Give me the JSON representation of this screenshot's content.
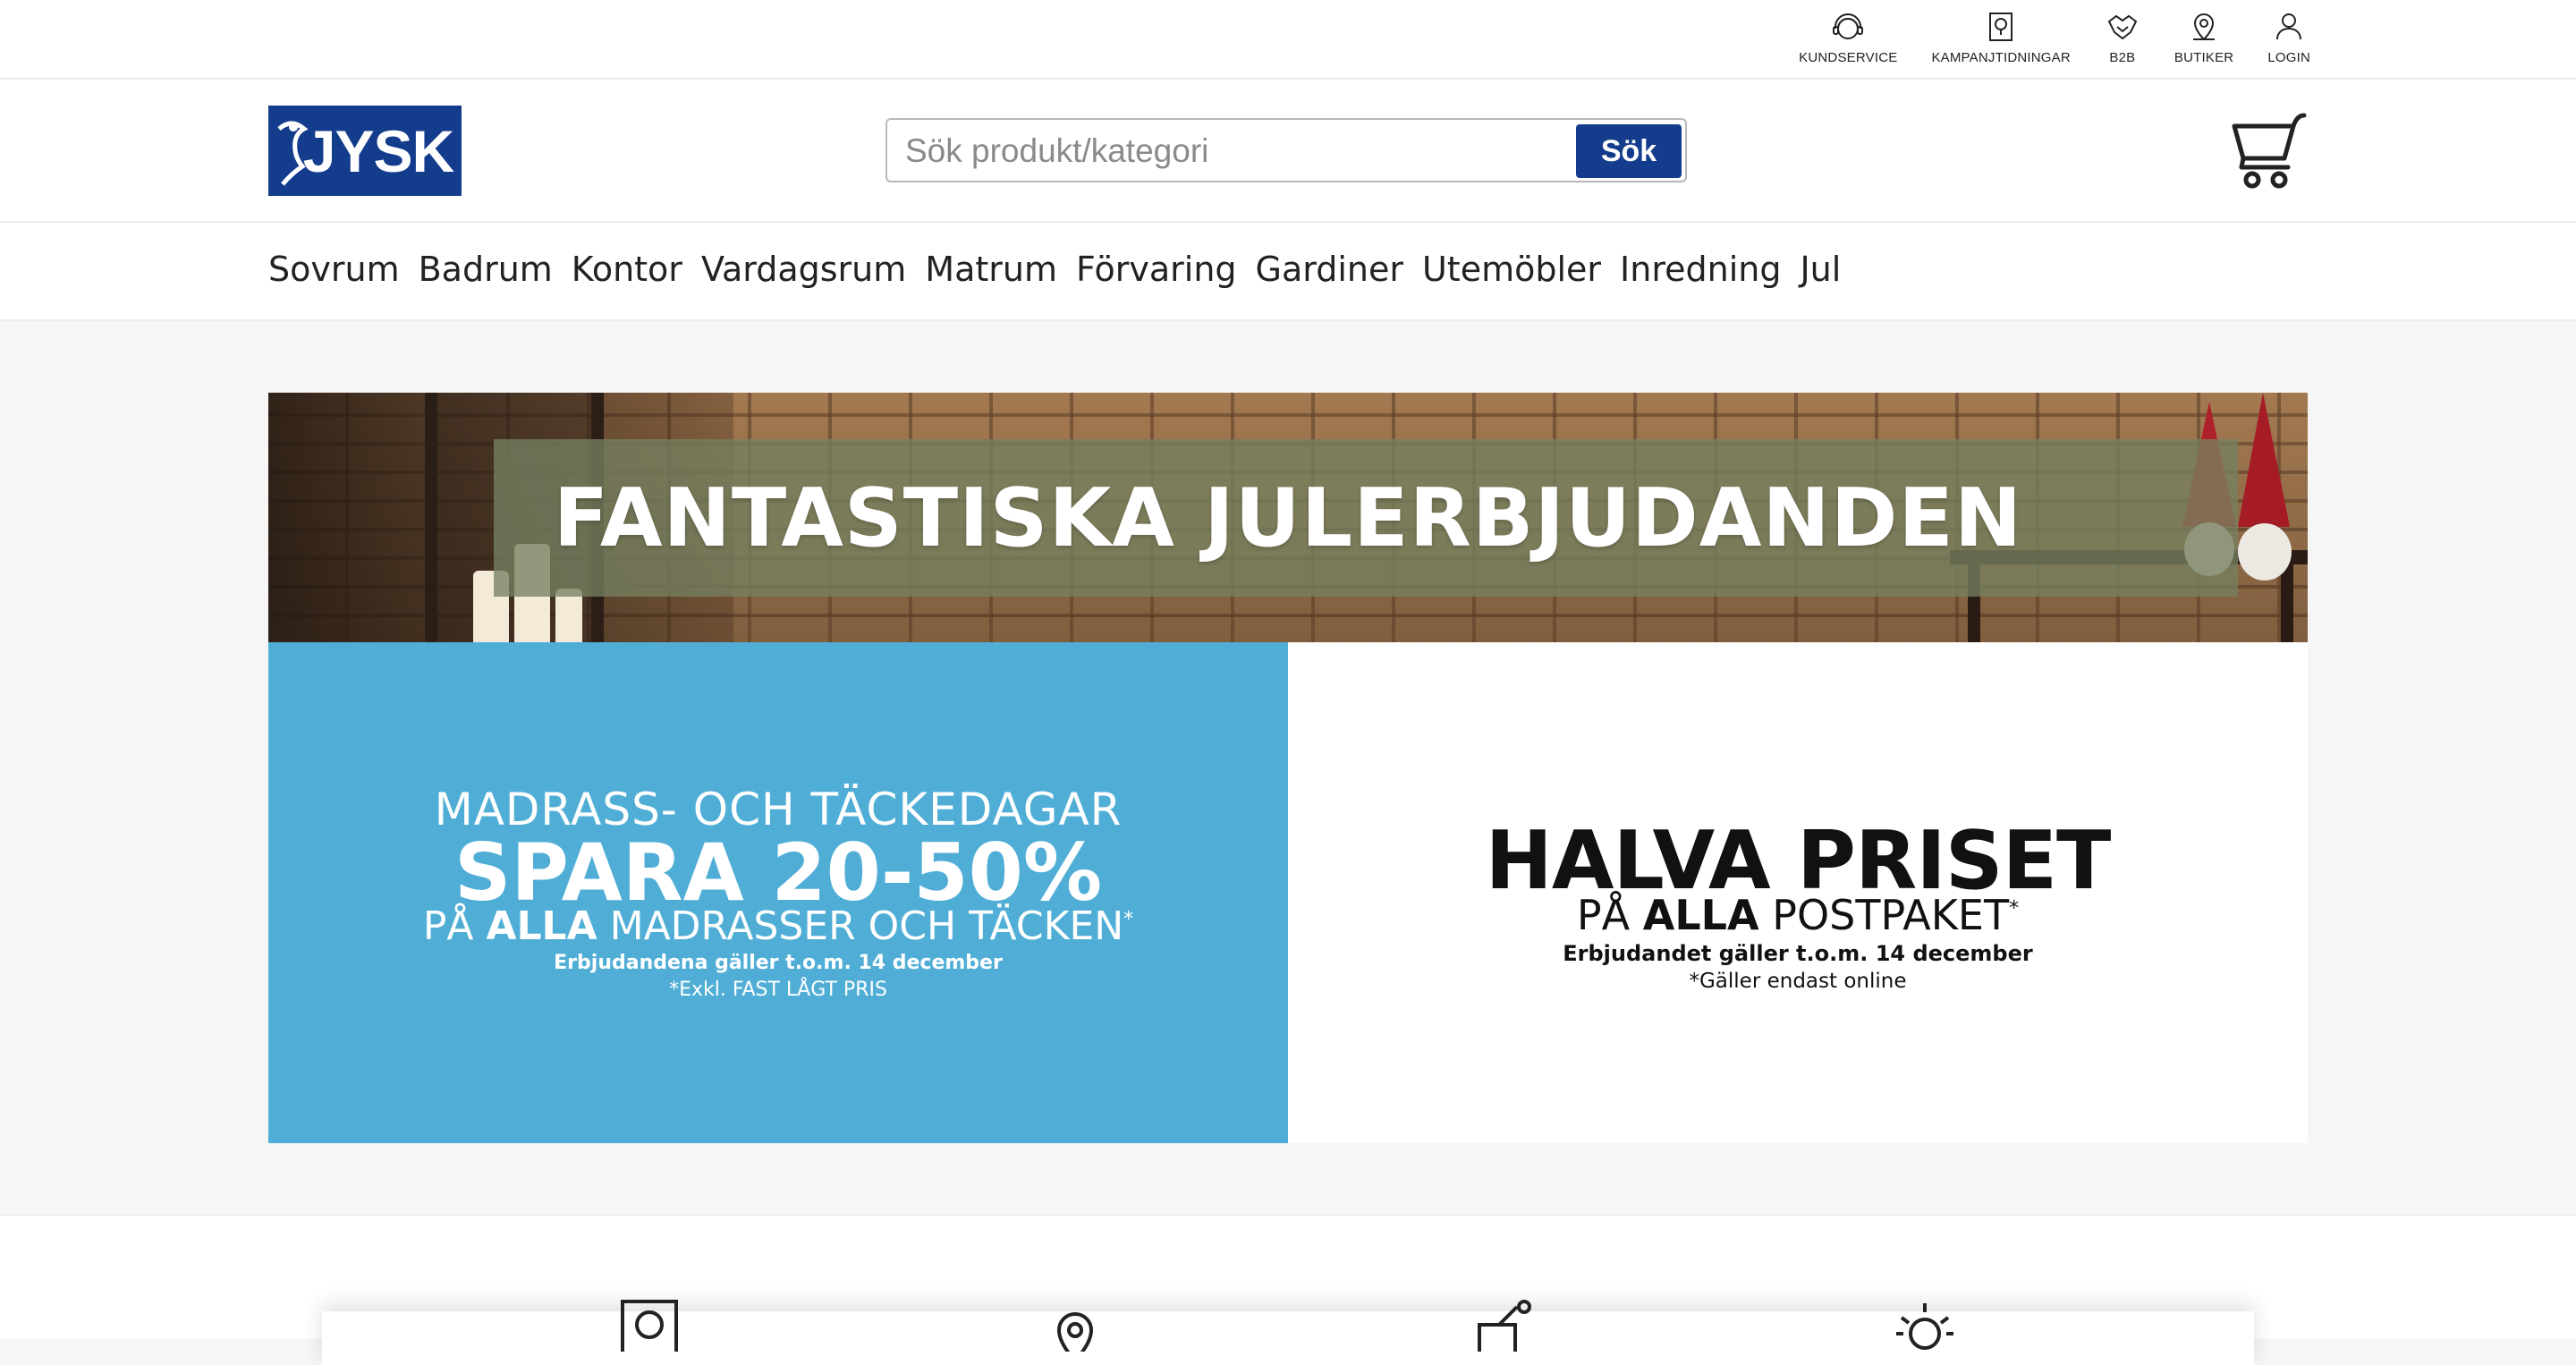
{
  "utility_nav": [
    {
      "label": "KUNDSERVICE",
      "icon": "customer-service-icon"
    },
    {
      "label": "KAMPANJTIDNINGAR",
      "icon": "catalog-icon"
    },
    {
      "label": "B2B",
      "icon": "handshake-icon"
    },
    {
      "label": "BUTIKER",
      "icon": "store-location-icon"
    },
    {
      "label": "LOGIN",
      "icon": "user-icon"
    }
  ],
  "header": {
    "logo_text": "JYSK",
    "search_placeholder": "Sök produkt/kategori",
    "search_button": "Sök",
    "brand_color": "#143c8c"
  },
  "main_nav": [
    "Sovrum",
    "Badrum",
    "Kontor",
    "Vardagsrum",
    "Matrum",
    "Förvaring",
    "Gardiner",
    "Utemöbler",
    "Inredning",
    "Jul"
  ],
  "hero": {
    "top_banner": "FANTASTISKA JULERBJUDANDEN",
    "left_banner": {
      "line1": "MADRASS- OCH TÄCKEDAGAR",
      "line2": "SPARA 20-50%",
      "line3_pre": "PÅ ",
      "line3_bold": "ALLA",
      "line3_post": " MADRASSER OCH TÄCKEN",
      "line3_sup": "*",
      "line4": "Erbjudandena gäller t.o.m. 14 december",
      "line5": "*Exkl. FAST LÅGT PRIS",
      "bg_color": "#50aed6"
    },
    "right_banner": {
      "line1": "HALVA PRISET",
      "line2_pre": "PÅ ",
      "line2_bold": "ALLA",
      "line2_post": " POSTPAKET",
      "line2_sup": "*",
      "line3": "Erbjudandet gäller t.o.m. 14 december",
      "line4": "*Gäller endast online"
    }
  },
  "bottom_icons": [
    "catalog-icon",
    "location-pin-icon",
    "delivery-icon",
    "sun-icon"
  ]
}
